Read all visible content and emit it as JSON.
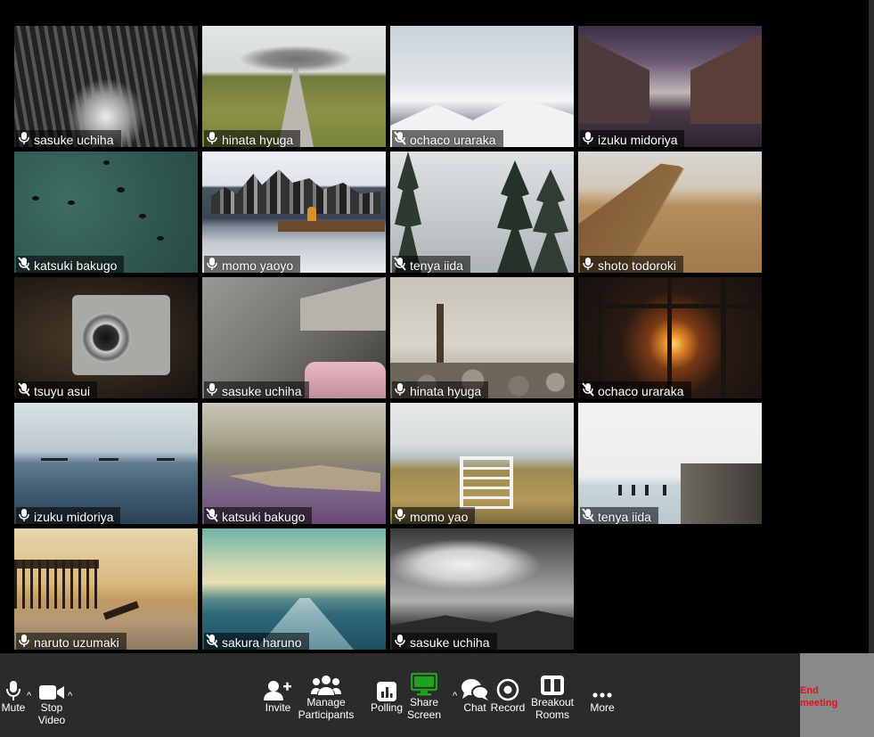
{
  "participants": [
    {
      "name": "sasuke uchiha",
      "muted": false
    },
    {
      "name": "hinata hyuga",
      "muted": false
    },
    {
      "name": "ochaco uraraka",
      "muted": true
    },
    {
      "name": "izuku midoriya",
      "muted": false
    },
    {
      "name": "katsuki bakugo",
      "muted": true
    },
    {
      "name": "momo yaoyo",
      "muted": false
    },
    {
      "name": "tenya iida",
      "muted": true
    },
    {
      "name": "shoto todoroki",
      "muted": false
    },
    {
      "name": "tsuyu asui",
      "muted": true
    },
    {
      "name": "sasuke uchiha",
      "muted": false
    },
    {
      "name": "hinata hyuga",
      "muted": false
    },
    {
      "name": "ochaco uraraka",
      "muted": true
    },
    {
      "name": "izuku midoriya",
      "muted": false
    },
    {
      "name": "katsuki bakugo",
      "muted": true
    },
    {
      "name": "momo yao",
      "muted": false
    },
    {
      "name": "tenya iida",
      "muted": true
    },
    {
      "name": "naruto uzumaki",
      "muted": false
    },
    {
      "name": "sakura haruno",
      "muted": true
    },
    {
      "name": "sasuke uchiha",
      "muted": false
    }
  ],
  "toolbar": {
    "mute": "Mute",
    "stop_video": "Stop Video",
    "invite": "Invite",
    "manage_participants": "Manage Participants",
    "polling": "Polling",
    "share_screen": "Share Screen",
    "chat": "Chat",
    "record": "Record",
    "breakout_rooms": "Breakout Rooms",
    "more": "More",
    "end_meeting": "End meeting"
  },
  "icons": {
    "mic": "microphone-icon",
    "mic_muted": "microphone-muted-icon",
    "video": "video-camera-icon",
    "invite": "add-person-icon",
    "participants": "people-icon",
    "polling": "bar-chart-icon",
    "share": "monitor-icon",
    "chat": "chat-bubbles-icon",
    "record": "record-icon",
    "breakout": "grid-rooms-icon",
    "more": "ellipsis-icon",
    "caret": "caret-up-icon"
  },
  "colors": {
    "background": "#000000",
    "toolbar": "#2b2b2b",
    "share_accent": "#1fa01f",
    "end_meeting_text": "#e0111a",
    "end_meeting_bg": "#8a8a8a"
  }
}
